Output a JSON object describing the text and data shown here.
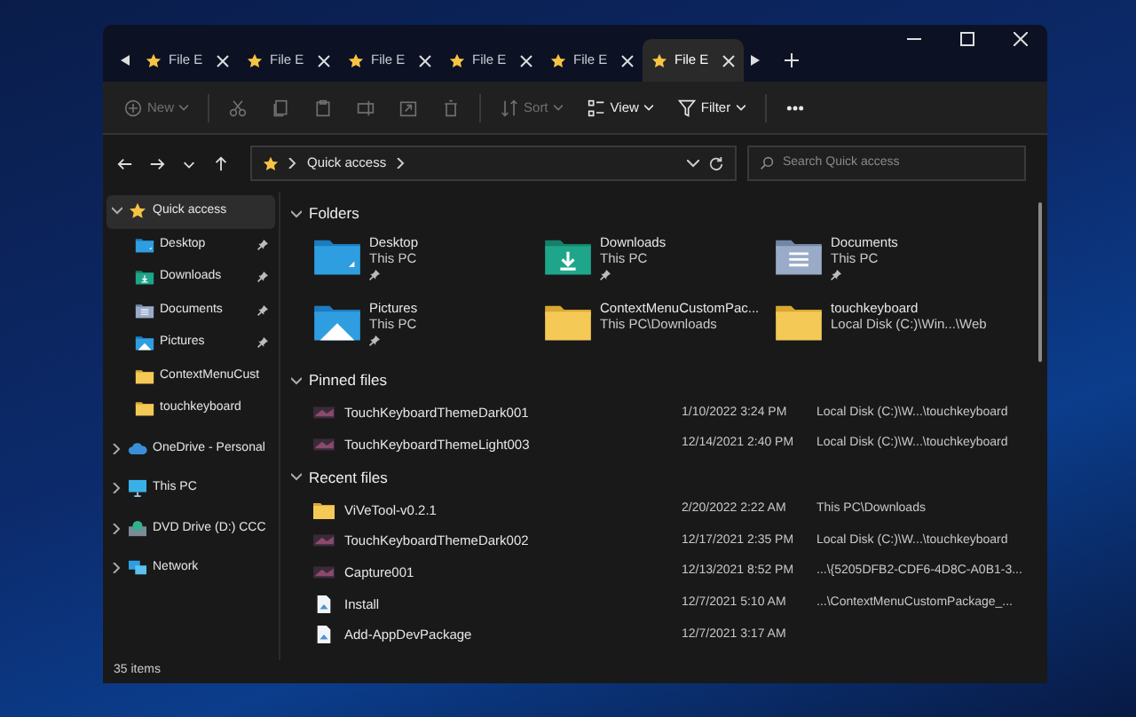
{
  "tabs": [
    {
      "label": "File E",
      "selected": false
    },
    {
      "label": "File E",
      "selected": false
    },
    {
      "label": "File E",
      "selected": false
    },
    {
      "label": "File E",
      "selected": false
    },
    {
      "label": "File E",
      "selected": false
    },
    {
      "label": "File E",
      "selected": true
    }
  ],
  "toolbar": [
    {
      "kind": "new",
      "label": "New",
      "disabled": true
    },
    {
      "kind": "cut",
      "disabled": true
    },
    {
      "kind": "copy",
      "disabled": true
    },
    {
      "kind": "paste",
      "disabled": true
    },
    {
      "kind": "rename",
      "disabled": true
    },
    {
      "kind": "share",
      "disabled": true
    },
    {
      "kind": "delete",
      "disabled": true
    },
    {
      "kind": "sort",
      "label": "Sort",
      "disabled": true
    },
    {
      "kind": "view",
      "label": "View",
      "disabled": false
    },
    {
      "kind": "filter",
      "label": "Filter",
      "disabled": false
    },
    {
      "kind": "more",
      "disabled": false
    }
  ],
  "address": {
    "path": [
      "Quick access"
    ]
  },
  "search": {
    "placeholder": "Search Quick access"
  },
  "sidebar": {
    "items": [
      {
        "label": "Quick access",
        "kind": "star",
        "expanded": true,
        "selected": true,
        "children": [
          {
            "label": "Desktop",
            "kind": "desktop",
            "pinned": true,
            "selected": false
          },
          {
            "label": "Downloads",
            "kind": "downloads",
            "pinned": true,
            "selected": false
          },
          {
            "label": "Documents",
            "kind": "documents",
            "pinned": true,
            "selected": false
          },
          {
            "label": "Pictures",
            "kind": "pictures",
            "pinned": true,
            "selected": false
          },
          {
            "label": "ContextMenuCust",
            "kind": "folder",
            "pinned": false,
            "selected": false
          },
          {
            "label": "touchkeyboard",
            "kind": "folder",
            "pinned": false,
            "selected": false
          }
        ]
      },
      {
        "label": "OneDrive - Personal",
        "kind": "onedrive",
        "expanded": false,
        "selected": false
      },
      {
        "label": "This PC",
        "kind": "pc",
        "expanded": false,
        "selected": false
      },
      {
        "label": "DVD Drive (D:) CCC",
        "kind": "dvd",
        "expanded": false,
        "selected": false
      },
      {
        "label": "Network",
        "kind": "network",
        "expanded": false,
        "selected": false
      }
    ]
  },
  "sections": [
    {
      "title": "Folders",
      "kind": "grid",
      "expanded": true,
      "items": [
        {
          "name": "Desktop",
          "location": "This PC",
          "kind": "desktop",
          "pinned": true
        },
        {
          "name": "Downloads",
          "location": "This PC",
          "kind": "downloads",
          "pinned": true
        },
        {
          "name": "Documents",
          "location": "This PC",
          "kind": "documents",
          "pinned": true
        },
        {
          "name": "Pictures",
          "location": "This PC",
          "kind": "pictures",
          "pinned": true
        },
        {
          "name": "ContextMenuCustomPac...",
          "location": "This PC\\Downloads",
          "kind": "folder",
          "pinned": false
        },
        {
          "name": "touchkeyboard",
          "location": "Local Disk (C:)\\Win...\\Web",
          "kind": "folder",
          "pinned": false
        }
      ]
    },
    {
      "title": "Pinned files",
      "kind": "list",
      "expanded": true,
      "items": [
        {
          "name": "TouchKeyboardThemeDark001",
          "date": "1/10/2022 3:24 PM",
          "location": "Local Disk (C:)\\W...\\touchkeyboard",
          "kind": "image"
        },
        {
          "name": "TouchKeyboardThemeLight003",
          "date": "12/14/2021 2:40 PM",
          "location": "Local Disk (C:)\\W...\\touchkeyboard",
          "kind": "image"
        }
      ]
    },
    {
      "title": "Recent files",
      "kind": "list",
      "expanded": true,
      "items": [
        {
          "name": "ViVeTool-v0.2.1",
          "date": "2/20/2022 2:22 AM",
          "location": "This PC\\Downloads",
          "kind": "folder"
        },
        {
          "name": "TouchKeyboardThemeDark002",
          "date": "12/17/2021 2:35 PM",
          "location": "Local Disk (C:)\\W...\\touchkeyboard",
          "kind": "image"
        },
        {
          "name": "Capture001",
          "date": "12/13/2021 8:52 PM",
          "location": "...\\{5205DFB2-CDF6-4D8C-A0B1-3...",
          "kind": "image"
        },
        {
          "name": "Install",
          "date": "12/7/2021 5:10 AM",
          "location": "...\\ContextMenuCustomPackage_...",
          "kind": "script"
        },
        {
          "name": "Add-AppDevPackage",
          "date": "12/7/2021 3:17 AM",
          "kind": "script"
        }
      ]
    }
  ],
  "status_bar": {
    "count": "35 items"
  }
}
